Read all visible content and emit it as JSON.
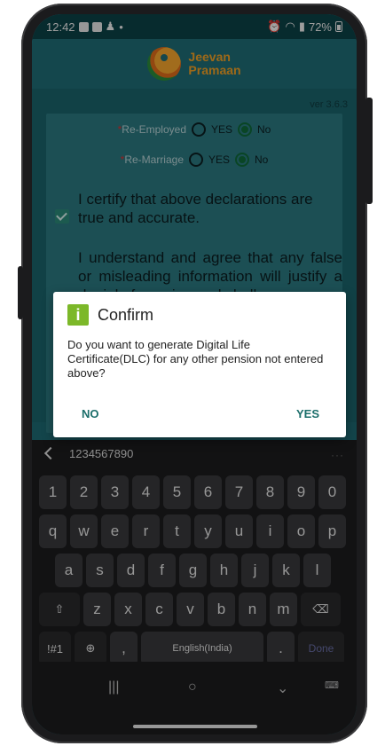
{
  "status_bar": {
    "time": "12:42",
    "battery": "72%"
  },
  "app": {
    "name_line1": "Jeevan",
    "name_line2": "Pramaan",
    "version": "ver 3.6.3"
  },
  "form": {
    "re_employed": {
      "label": "Re-Employed",
      "yes": "YES",
      "no": "No",
      "selected": "No"
    },
    "re_marriage": {
      "label": "Re-Marriage",
      "yes": "YES",
      "no": "No",
      "selected": "No"
    },
    "required_mark": "*",
    "declaration1": "I certify that above declarations are true and accurate.",
    "declaration2": "I understand and agree that any false or misleading information will justify a denial of pension and shall"
  },
  "dialog": {
    "title": "Confirm",
    "message": "Do you want to generate Digital Life Certificate(DLC) for any other pension not entered above?",
    "no_label": "NO",
    "yes_label": "YES"
  },
  "keyboard": {
    "suggestion": "1234567890",
    "row_numbers": [
      "1",
      "2",
      "3",
      "4",
      "5",
      "6",
      "7",
      "8",
      "9",
      "0"
    ],
    "row_q": [
      "q",
      "w",
      "e",
      "r",
      "t",
      "y",
      "u",
      "i",
      "o",
      "p"
    ],
    "row_a": [
      "a",
      "s",
      "d",
      "f",
      "g",
      "h",
      "j",
      "k",
      "l"
    ],
    "row_z": [
      "z",
      "x",
      "c",
      "v",
      "b",
      "n",
      "m"
    ],
    "sym_label": "!#1",
    "comma": ",",
    "space_label": "English(India)",
    "period": ".",
    "done_label": "Done"
  },
  "colors": {
    "accent": "#1b6e6a",
    "app_bg": "#1e6b73",
    "info_green": "#7cb829"
  }
}
